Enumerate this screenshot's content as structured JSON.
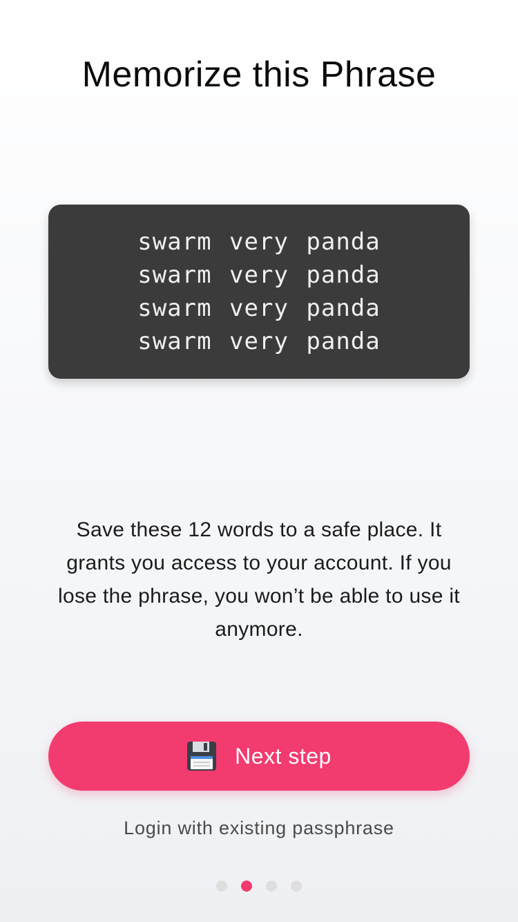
{
  "title": "Memorize this Phrase",
  "phrase": "swarm very panda swarm very panda swarm very panda swarm very panda",
  "description": "Save these 12 words to a safe place. It grants you access to your account. If you lose the phrase, you won’t be able to use it anymore.",
  "next_button": {
    "icon": "floppy-disk-icon",
    "label": "Next step"
  },
  "login_link": "Login with existing passphrase",
  "pager": {
    "total": 4,
    "active_index": 1
  },
  "colors": {
    "accent": "#f23b6f",
    "card": "#3b3b3b",
    "dot_inactive": "#dedede"
  }
}
